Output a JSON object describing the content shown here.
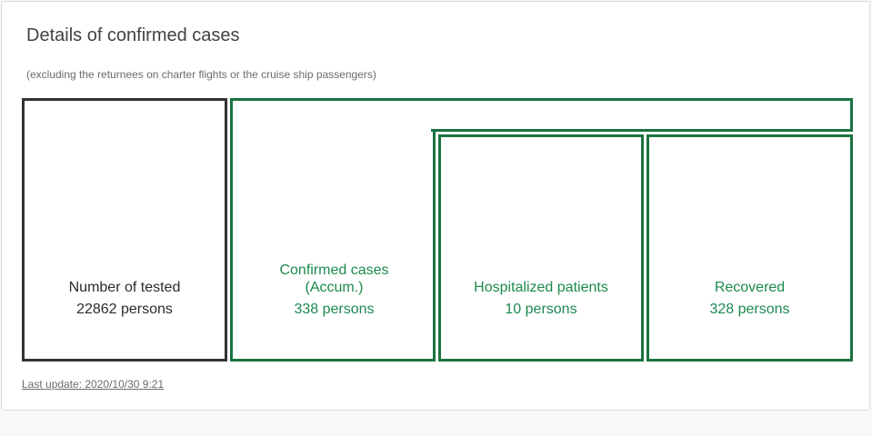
{
  "panel": {
    "title": "Details of confirmed cases",
    "subtitle": "(excluding the returnees on charter flights or the cruise ship passengers)",
    "last_update": "Last update: 2020/10/30 9:21"
  },
  "boxes": {
    "tested": {
      "label": "Number of tested",
      "value": "22862 persons"
    },
    "confirmed": {
      "label_line1": "Confirmed cases",
      "label_line2": "(Accum.)",
      "value": "338 persons"
    },
    "hospitalized": {
      "label": "Hospitalized patients",
      "value": "10 persons"
    },
    "recovered": {
      "label": "Recovered",
      "value": "328 persons"
    }
  },
  "colors": {
    "accent_green": "#1b7341",
    "text_green": "#1b8a4e",
    "tested_border": "#333333"
  }
}
